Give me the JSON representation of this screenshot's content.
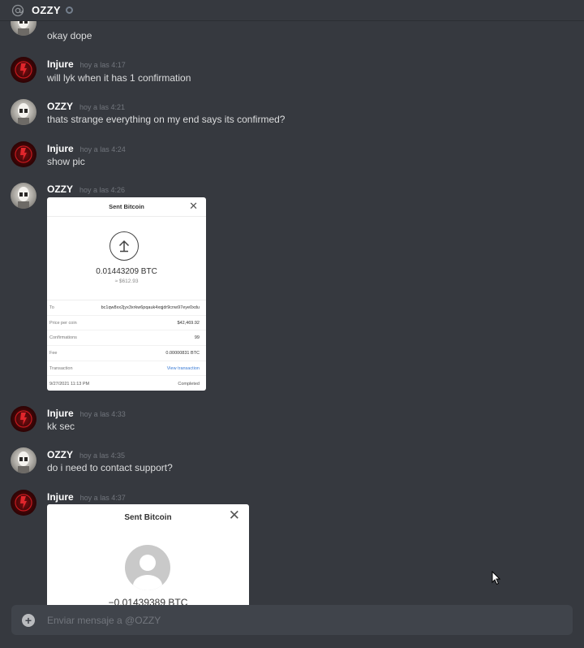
{
  "header": {
    "title": "OZZY",
    "icon": "at-icon"
  },
  "messages": [
    {
      "author": "",
      "time": "",
      "text": "okay dope",
      "avatar": "ozzy"
    },
    {
      "author": "Injure",
      "time": "hoy a las 4:17",
      "text": "will lyk when it has 1 confirmation",
      "avatar": "injure"
    },
    {
      "author": "OZZY",
      "time": "hoy a las 4:21",
      "text": "thats strange everything on my end says its confirmed?",
      "avatar": "ozzy"
    },
    {
      "author": "Injure",
      "time": "hoy a las 4:24",
      "text": "show pic",
      "avatar": "injure"
    },
    {
      "author": "OZZY",
      "time": "hoy a las 4:26",
      "text": "",
      "avatar": "ozzy"
    },
    {
      "author": "Injure",
      "time": "hoy a las 4:33",
      "text": "kk sec",
      "avatar": "injure"
    },
    {
      "author": "OZZY",
      "time": "hoy a las 4:35",
      "text": "do i need to contact support?",
      "avatar": "ozzy"
    },
    {
      "author": "Injure",
      "time": "hoy a las 4:37",
      "text": "",
      "avatar": "injure"
    }
  ],
  "receipt1": {
    "title": "Sent Bitcoin",
    "close": "✕",
    "amount": "0.01443209 BTC",
    "usd": "≈ $612.93",
    "rows": [
      {
        "label": "To",
        "value": "bc1qw8xx2jyx3xrkw6pqauk4xqjdr9cnw97eye0xdu",
        "link": false
      },
      {
        "label": "Price per coin",
        "value": "$42,469.92",
        "link": false
      },
      {
        "label": "Confirmations",
        "value": "99",
        "link": false
      },
      {
        "label": "Fee",
        "value": "0.00000831 BTC",
        "link": false
      },
      {
        "label": "Transaction",
        "value": "View transaction",
        "link": true
      }
    ],
    "date": "9/27/2021 11:13 PM",
    "status": "Completed"
  },
  "receipt2": {
    "title": "Sent Bitcoin",
    "close": "✕",
    "amount": "−0.01439389 BTC"
  },
  "composer": {
    "placeholder": "Enviar mensaje a @OZZY",
    "plus": "+"
  },
  "colors": {
    "background": "#36393f",
    "composer": "#40444b",
    "author": "#ffffff",
    "timestamp": "#72767d",
    "link": "#3a7bd5"
  }
}
